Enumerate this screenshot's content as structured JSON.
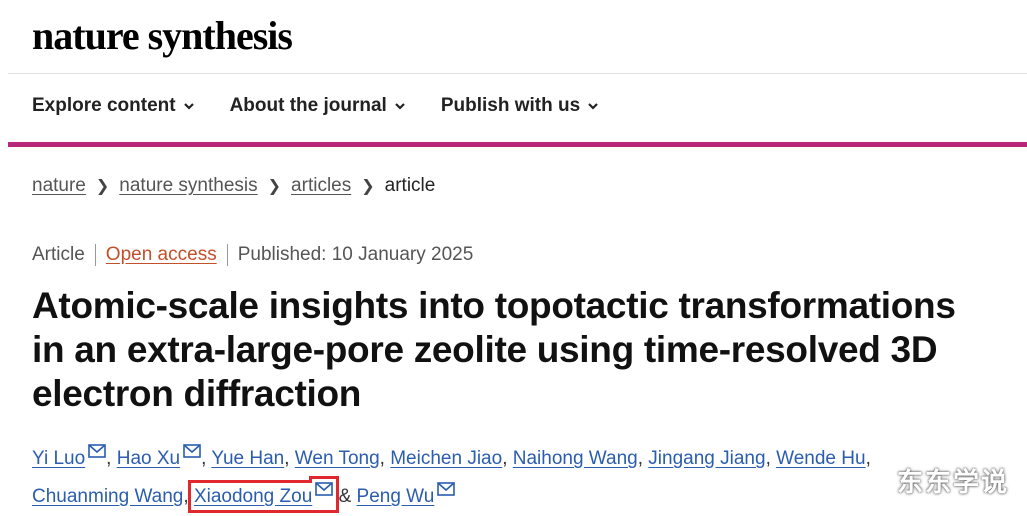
{
  "header": {
    "logo": "nature synthesis"
  },
  "nav": {
    "items": [
      {
        "label": "Explore content"
      },
      {
        "label": "About the journal"
      },
      {
        "label": "Publish with us"
      }
    ]
  },
  "breadcrumb": {
    "items": [
      "nature",
      "nature synthesis",
      "articles",
      "article"
    ]
  },
  "article": {
    "type": "Article",
    "access": "Open access",
    "published": "Published: 10 January 2025",
    "title": "Atomic-scale insights into topotactic transformations in an extra-large-pore zeolite using time-resolved 3D electron diffraction",
    "authors": [
      "Yi Luo",
      "Hao Xu",
      "Yue Han",
      "Wen Tong",
      "Meichen Jiao",
      "Naihong Wang",
      "Jingang Jiang",
      "Wende Hu",
      "Chuanming Wang",
      "Xiaodong Zou",
      "Peng Wu"
    ],
    "ampersand": "&"
  },
  "colors": {
    "accent": "#b8287a",
    "link": "#2a5db0",
    "open_access": "#c2502a",
    "highlight": "#e0282e"
  },
  "icons": {
    "nav_chevron": "chevron-down-icon",
    "author_mail": "mail-icon"
  },
  "watermark": "东东学说"
}
